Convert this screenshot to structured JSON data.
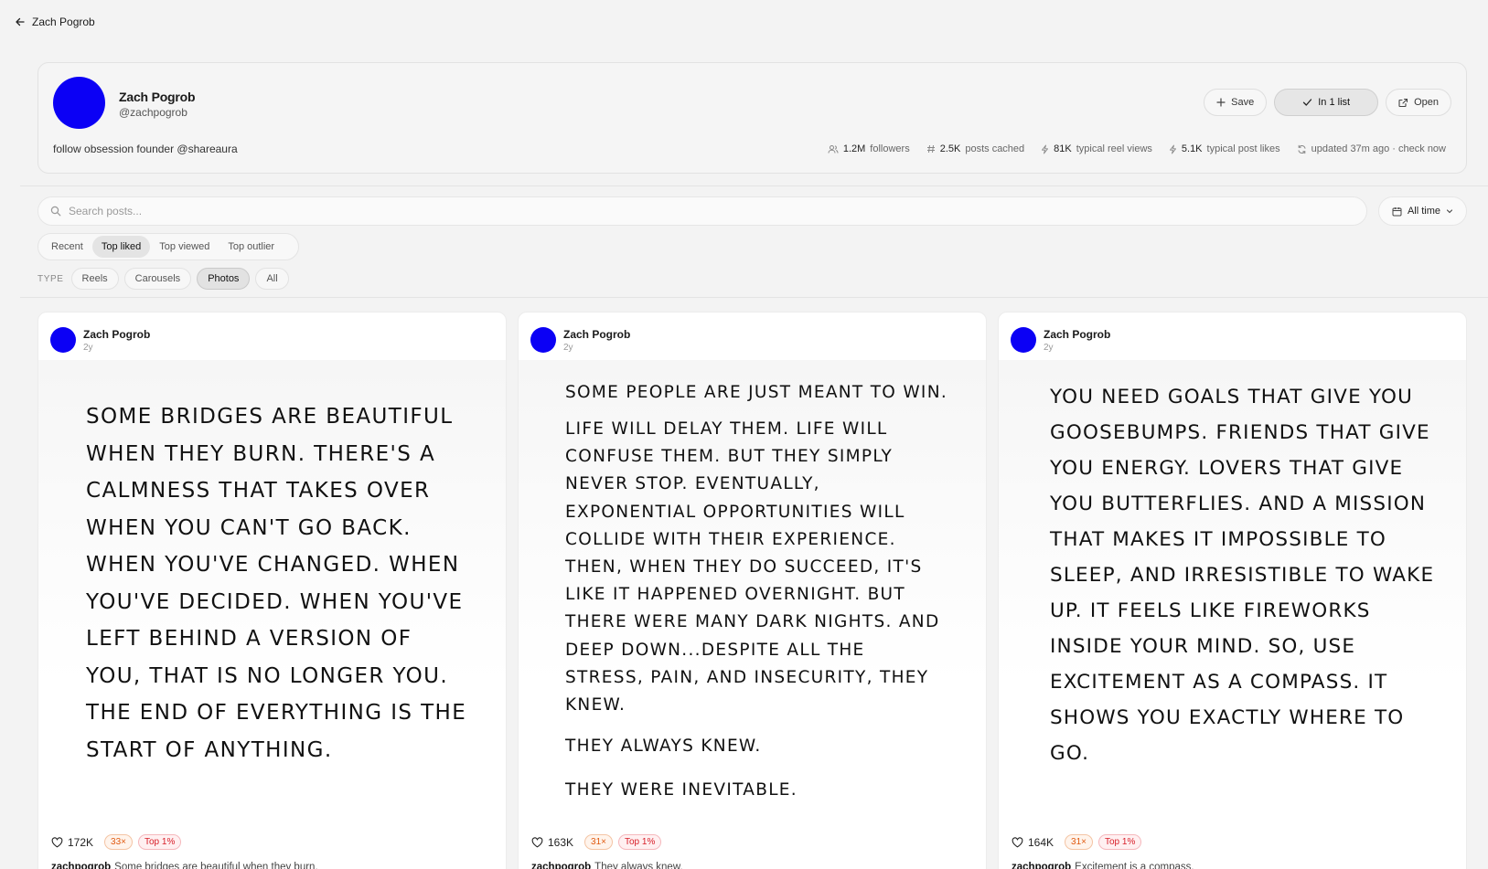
{
  "nav": {
    "back_label": "Zach Pogrob"
  },
  "profile": {
    "name": "Zach Pogrob",
    "handle": "@zachpogrob",
    "bio": "follow obsession founder @shareaura",
    "avatar_color": "#0b00f5",
    "actions": {
      "save": "Save",
      "in_list": "In 1 list",
      "open": "Open"
    },
    "stats": {
      "followers_value": "1.2M",
      "followers_label": "followers",
      "posts_value": "2.5K",
      "posts_label": "posts cached",
      "reel_views_value": "81K",
      "reel_views_label": "typical reel views",
      "post_likes_value": "5.1K",
      "post_likes_label": "typical post likes",
      "updated": "updated 37m ago · check now"
    }
  },
  "search": {
    "placeholder": "Search posts..."
  },
  "time_filter": {
    "label": "All time"
  },
  "sort_tabs": [
    "Recent",
    "Top liked",
    "Top viewed",
    "Top outlier"
  ],
  "sort_active": "Top liked",
  "type_filter": {
    "label": "TYPE",
    "options": [
      "Reels",
      "Carousels",
      "Photos",
      "All"
    ],
    "active": "Photos"
  },
  "posts": [
    {
      "author": "Zach Pogrob",
      "age": "2y",
      "quote": "Some bridges are beautiful when they burn. There's a calmness that takes over when you can't go back. When you've changed. When you've decided. When you've left behind a version of you, that is no longer you. The end of everything is the start of anything.",
      "likes": "172K",
      "multiplier": "33×",
      "rank": "Top 1%",
      "caption_user": "zachpogrob",
      "caption_text": "Some bridges are beautiful when they burn."
    },
    {
      "author": "Zach Pogrob",
      "age": "2y",
      "quote_p1": "Some people are just meant to win.",
      "quote_p2": "Life will delay them. Life will confuse them. But they simply never stop. Eventually, exponential opportunities will collide with their experience. Then, when they do succeed, it's like it happened overnight. But there were many dark nights. And deep down...despite all the stress, pain, and insecurity, they knew.",
      "quote_p3": "They always knew.",
      "quote_p4": "They were inevitable.",
      "likes": "163K",
      "multiplier": "31×",
      "rank": "Top 1%",
      "caption_user": "zachpogrob",
      "caption_text": "They always knew."
    },
    {
      "author": "Zach Pogrob",
      "age": "2y",
      "quote": "You need goals that give you goosebumps. Friends that give you energy. Lovers that give you butterflies. And a mission that makes it impossible to sleep, and irresistible to wake up. It feels like fireworks inside your mind. So, use excitement as a compass. It shows you exactly where to go.",
      "likes": "164K",
      "multiplier": "31×",
      "rank": "Top 1%",
      "caption_user": "zachpogrob",
      "caption_text": "Excitement is a compass."
    }
  ]
}
